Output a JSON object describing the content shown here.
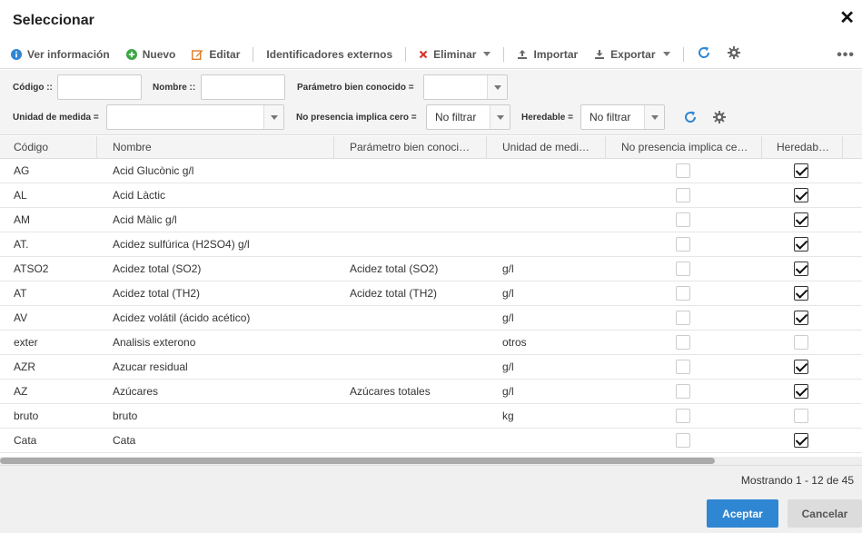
{
  "window": {
    "title": "Seleccionar"
  },
  "toolbar": {
    "view_info": "Ver información",
    "new": "Nuevo",
    "edit": "Editar",
    "external_ids": "Identificadores externos",
    "delete": "Eliminar",
    "import": "Importar",
    "export": "Exportar"
  },
  "filters": {
    "codigo_label": "Código ::",
    "codigo_value": "",
    "nombre_label": "Nombre ::",
    "nombre_value": "",
    "parametro_label": "Parámetro bien conocido =",
    "parametro_value": "",
    "unidad_label": "Unidad de medida =",
    "unidad_value": "",
    "no_presencia_label": "No presencia implica cero =",
    "no_presencia_value": "No filtrar",
    "heredable_label": "Heredable =",
    "heredable_value": "No filtrar"
  },
  "columns": [
    "Código",
    "Nombre",
    "Parámetro bien conoci…",
    "Unidad de medi…",
    "No presencia implica ce…",
    "Heredab…"
  ],
  "rows": [
    {
      "codigo": "AG",
      "nombre": "Acid Glucònic g/l",
      "parametro": "",
      "unidad": "",
      "no_presencia": false,
      "heredable": true
    },
    {
      "codigo": "AL",
      "nombre": "Acid Làctic",
      "parametro": "",
      "unidad": "",
      "no_presencia": false,
      "heredable": true
    },
    {
      "codigo": "AM",
      "nombre": "Acid Màlic g/l",
      "parametro": "",
      "unidad": "",
      "no_presencia": false,
      "heredable": true
    },
    {
      "codigo": "AT.",
      "nombre": "Acidez sulfúrica (H2SO4) g/l",
      "parametro": "",
      "unidad": "",
      "no_presencia": false,
      "heredable": true
    },
    {
      "codigo": "ATSO2",
      "nombre": "Acidez total (SO2)",
      "parametro": "Acidez total (SO2)",
      "unidad": "g/l",
      "no_presencia": false,
      "heredable": true
    },
    {
      "codigo": "AT",
      "nombre": "Acidez total (TH2)",
      "parametro": "Acidez total (TH2)",
      "unidad": "g/l",
      "no_presencia": false,
      "heredable": true
    },
    {
      "codigo": "AV",
      "nombre": "Acidez volátil (ácido acético)",
      "parametro": "",
      "unidad": "g/l",
      "no_presencia": false,
      "heredable": true
    },
    {
      "codigo": "exter",
      "nombre": "Analisis exterono",
      "parametro": "",
      "unidad": "otros",
      "no_presencia": false,
      "heredable": false
    },
    {
      "codigo": "AZR",
      "nombre": "Azucar residual",
      "parametro": "",
      "unidad": "g/l",
      "no_presencia": false,
      "heredable": true
    },
    {
      "codigo": "AZ",
      "nombre": "Azúcares",
      "parametro": "Azúcares totales",
      "unidad": "g/l",
      "no_presencia": false,
      "heredable": true
    },
    {
      "codigo": "bruto",
      "nombre": "bruto",
      "parametro": "",
      "unidad": "kg",
      "no_presencia": false,
      "heredable": false
    },
    {
      "codigo": "Cata",
      "nombre": "Cata",
      "parametro": "",
      "unidad": "",
      "no_presencia": false,
      "heredable": true
    }
  ],
  "footer": {
    "paging": "Mostrando 1 - 12 de 45",
    "accept": "Aceptar",
    "cancel": "Cancelar"
  },
  "colors": {
    "accent": "#2f86d3",
    "info": "#2f86d3",
    "new": "#3aa645",
    "edit": "#e07b27",
    "delete": "#d9362b"
  }
}
